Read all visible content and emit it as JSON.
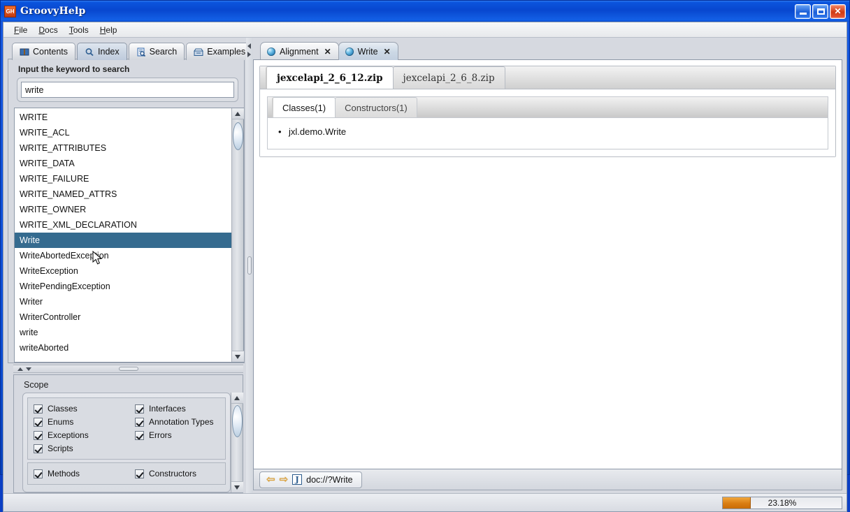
{
  "window": {
    "title": "GroovyHelp",
    "app_icon": "GH",
    "buttons": {
      "minimize": "minimize-icon",
      "maximize": "maximize-icon",
      "close": "✕"
    }
  },
  "menubar": {
    "items": [
      {
        "label": "File",
        "mnemonic": "F"
      },
      {
        "label": "Docs",
        "mnemonic": "D"
      },
      {
        "label": "Tools",
        "mnemonic": "T"
      },
      {
        "label": "Help",
        "mnemonic": "H"
      }
    ]
  },
  "left_panel": {
    "tabs": [
      {
        "label": "Contents",
        "icon": "book-icon",
        "active": false
      },
      {
        "label": "Index",
        "icon": "magnifier-icon",
        "active": true
      },
      {
        "label": "Search",
        "icon": "document-search-icon",
        "active": false
      },
      {
        "label": "Examples",
        "icon": "archive-box-icon",
        "active": false
      }
    ],
    "search": {
      "label": "Input the keyword to search",
      "value": "write",
      "placeholder": ""
    },
    "results": [
      {
        "label": "WRITE",
        "selected": false
      },
      {
        "label": "WRITE_ACL",
        "selected": false
      },
      {
        "label": "WRITE_ATTRIBUTES",
        "selected": false
      },
      {
        "label": "WRITE_DATA",
        "selected": false
      },
      {
        "label": "WRITE_FAILURE",
        "selected": false
      },
      {
        "label": "WRITE_NAMED_ATTRS",
        "selected": false
      },
      {
        "label": "WRITE_OWNER",
        "selected": false
      },
      {
        "label": "WRITE_XML_DECLARATION",
        "selected": false
      },
      {
        "label": "Write",
        "selected": true
      },
      {
        "label": "WriteAbortedException",
        "selected": false
      },
      {
        "label": "WriteException",
        "selected": false
      },
      {
        "label": "WritePendingException",
        "selected": false
      },
      {
        "label": "Writer",
        "selected": false
      },
      {
        "label": "WriterController",
        "selected": false
      },
      {
        "label": "write",
        "selected": false
      },
      {
        "label": "writeAborted",
        "selected": false
      }
    ],
    "scope": {
      "title": "Scope",
      "checkboxes": [
        {
          "label": "Classes",
          "checked": true
        },
        {
          "label": "Interfaces",
          "checked": true
        },
        {
          "label": "Enums",
          "checked": true
        },
        {
          "label": "Annotation Types",
          "checked": true
        },
        {
          "label": "Exceptions",
          "checked": true
        },
        {
          "label": "Errors",
          "checked": true
        },
        {
          "label": "Scripts",
          "checked": true
        }
      ],
      "checkboxes_row2": [
        {
          "label": "Methods",
          "checked": true
        },
        {
          "label": "Constructors",
          "checked": true
        }
      ]
    }
  },
  "right_panel": {
    "tabs": [
      {
        "label": "Alignment",
        "icon": "globe-icon",
        "close": "✕",
        "active": false
      },
      {
        "label": "Write",
        "icon": "globe-icon",
        "close": "✕",
        "active": true
      }
    ],
    "doc_tabs": [
      {
        "label": "jexcelapi_2_6_12.zip",
        "active": true
      },
      {
        "label": "jexcelapi_2_6_8.zip",
        "active": false
      }
    ],
    "member_tabs": [
      {
        "label": "Classes(1)",
        "active": true
      },
      {
        "label": "Constructors(1)",
        "active": false
      }
    ],
    "items": [
      {
        "label": "jxl.demo.Write"
      }
    ],
    "navbar": {
      "back": "⇦",
      "forward": "⇨",
      "doc_icon": "J",
      "url": "doc://?Write"
    }
  },
  "statusbar": {
    "progress_text": "23.18%",
    "progress_value": 23.18,
    "accent_color": "#d97d12"
  }
}
